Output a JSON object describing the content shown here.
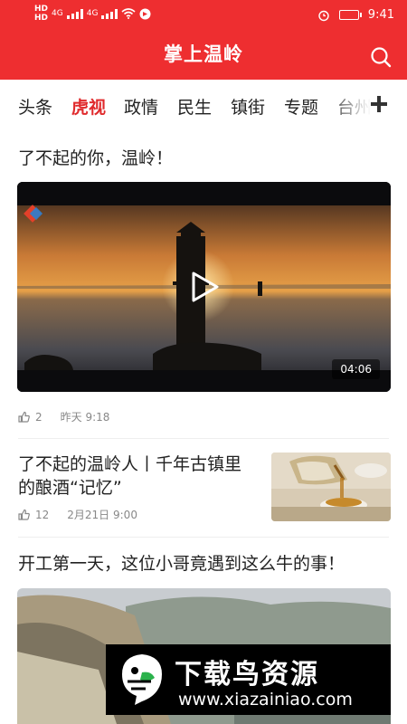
{
  "status_bar": {
    "left_indicators": [
      "HD",
      "HD",
      "4G",
      "4G"
    ],
    "time": "9:41"
  },
  "header": {
    "title": "掌上温岭",
    "background": "#ee2e30",
    "search_icon": "search-icon"
  },
  "tabs": {
    "items": [
      "头条",
      "虎视",
      "政情",
      "民生",
      "镇街",
      "专题",
      "台州"
    ],
    "active": "虎视",
    "active_color": "#e02a2c",
    "add_icon": "plus-icon"
  },
  "feed": [
    {
      "title": "了不起的你，温岭！",
      "duration": "04:06",
      "likes": "2",
      "time": "昨天 9:18"
    },
    {
      "title": "了不起的温岭人丨千年古镇里的酿酒“记忆”",
      "likes": "12",
      "time": "2月21日 9:00"
    },
    {
      "title": "开工第一天，这位小哥竟遇到这么牛的事！"
    }
  ],
  "watermark": {
    "brand": "下载鸟资源",
    "url": "www.xiazainiao.com"
  }
}
